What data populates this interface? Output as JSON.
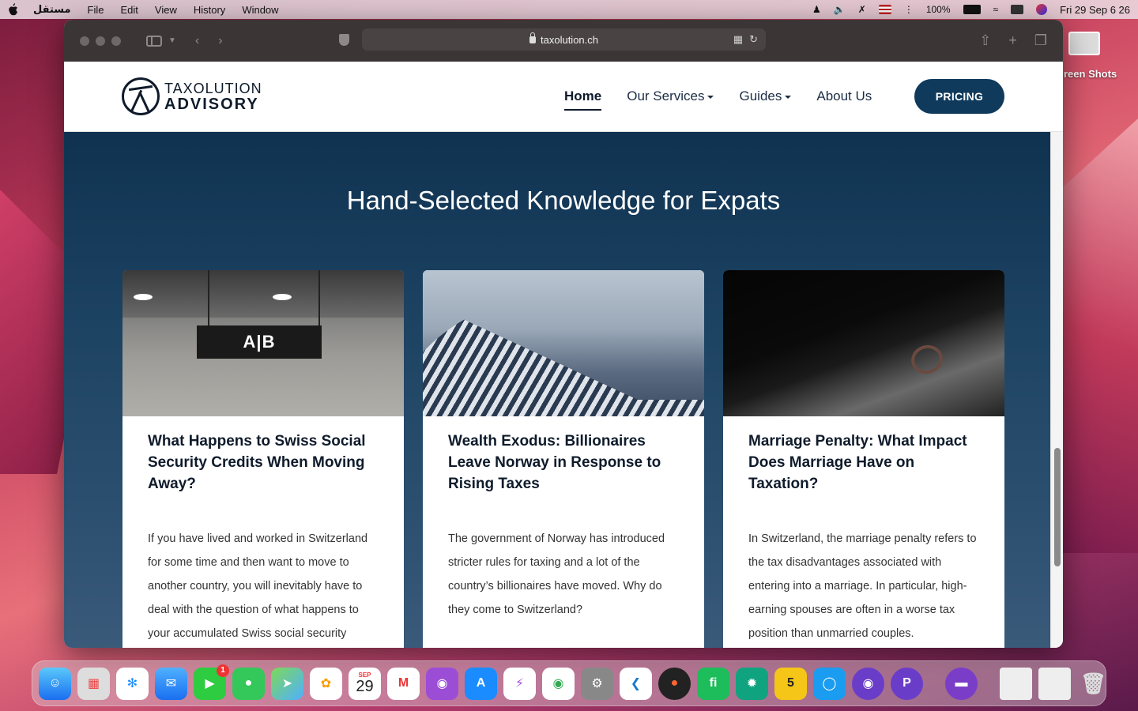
{
  "menubar": {
    "app_name": "مستقل",
    "items": [
      "File",
      "Edit",
      "View",
      "History",
      "Window"
    ],
    "battery": "100%",
    "clock": "Fri 29 Sep  6 26"
  },
  "browser": {
    "url": "taxolution.ch"
  },
  "site": {
    "logo_line1": "TAXOLUTION",
    "logo_line2": "ADVISORY",
    "nav": {
      "home": "Home",
      "services": "Our Services",
      "guides": "Guides",
      "about": "About Us"
    },
    "pricing_label": "PRICING",
    "headline": "Hand-Selected Knowledge for Expats",
    "cards": [
      {
        "title": "What Happens to Swiss Social Security Credits When Moving Away?",
        "text": "If you have lived and worked in Switzerland for some time and then want to move to another country, you will inevitably have to deal with the question of what happens to your accumulated Swiss social security credits."
      },
      {
        "title": "Wealth Exodus: Billionaires Leave Norway in Response to Rising Taxes",
        "text": "The government of Norway has introduced stricter rules for taxing and a lot of the country’s billionaires have moved. Why do they come to Switzerland?"
      },
      {
        "title": "Marriage Penalty: What Impact Does Marriage Have on Taxation?",
        "text": "In Switzerland, the marriage penalty refers to the tax disadvantages associated with entering into a marriage. In particular, high-earning spouses are often in a worse tax position than unmarried couples."
      }
    ],
    "img1_sign": "A|B"
  },
  "desktop": {
    "label": "reen Shots"
  },
  "dock": {
    "calendar_month": "SEP",
    "calendar_day": "29",
    "facetime_badge": "1"
  }
}
